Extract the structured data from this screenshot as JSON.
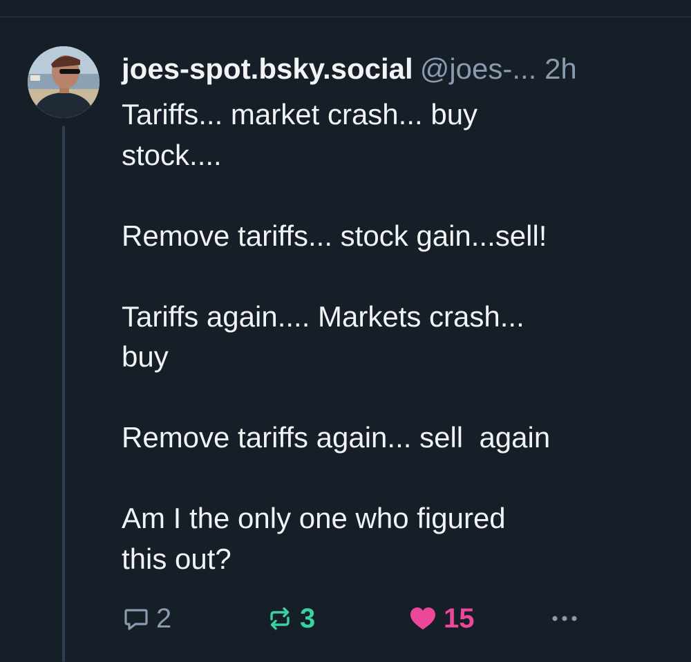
{
  "post": {
    "author": {
      "display_name": "joes-spot.bsky.social",
      "handle": "@joes-",
      "truncation": "...",
      "avatar_icon": "avatar-photo"
    },
    "time": "2h",
    "text": {
      "line_1": "Tariffs... market crash... buy",
      "line_2": "stock....",
      "line_3": "Remove tariffs... stock gain...sell!",
      "line_4": "Tariffs again.... Markets crash...",
      "line_5": "buy",
      "line_6": "Remove tariffs again... sell  again",
      "line_7": "Am I the only one who figured",
      "line_8": "this out?"
    },
    "actions": {
      "reply_count": "2",
      "repost_count": "3",
      "like_count": "15",
      "reply_icon": "comment-icon",
      "repost_icon": "repost-icon",
      "like_icon": "heart-icon",
      "more_icon": "more-icon"
    }
  },
  "colors": {
    "background": "#161e27",
    "text": "#f1f3f5",
    "muted": "#8a9bb0",
    "repost": "#3ad29f",
    "like": "#ec4899",
    "thread_line": "#2e3d50"
  }
}
